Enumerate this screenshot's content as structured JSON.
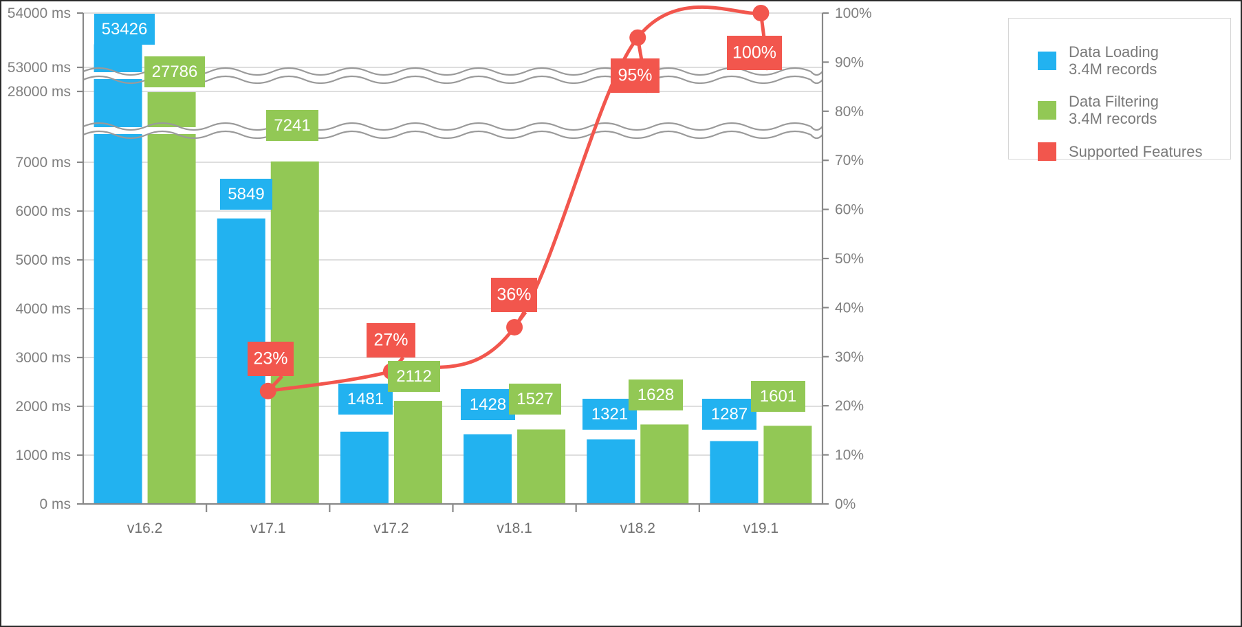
{
  "chart_data": {
    "type": "bar",
    "title": "",
    "subtitle": "",
    "xlabel": "",
    "ylabel": "",
    "y2label": "",
    "grid": true,
    "legend_position": "top-right",
    "broken_axis": true,
    "categories": [
      "v16.2",
      "v17.1",
      "v17.2",
      "v18.1",
      "v18.2",
      "v19.1"
    ],
    "series": [
      {
        "name": "Data Loading",
        "sublabel": "3.4M records",
        "type": "bar",
        "color": "#22b2f0",
        "axis": "left",
        "unit": "ms",
        "values": [
          53426,
          5849,
          1481,
          1428,
          1321,
          1287
        ]
      },
      {
        "name": "Data Filtering",
        "sublabel": "3.4M records",
        "type": "bar",
        "color": "#92c855",
        "axis": "left",
        "unit": "ms",
        "values": [
          27786,
          7241,
          2112,
          1527,
          1628,
          1601
        ]
      },
      {
        "name": "Supported Features",
        "sublabel": "",
        "type": "line",
        "color": "#f2564d",
        "axis": "right",
        "unit": "%",
        "values": [
          null,
          23,
          27,
          36,
          95,
          100
        ],
        "labels": [
          "",
          "23%",
          "27%",
          "36%",
          "95%",
          "100%"
        ]
      }
    ],
    "left_axis": {
      "unit": "ms",
      "tick_labels": [
        "54000 ms",
        "53000 ms",
        "28000 ms",
        "7000 ms",
        "6000 ms",
        "5000 ms",
        "4000 ms",
        "3000 ms",
        "2000 ms",
        "1000 ms",
        "0 ms"
      ],
      "tick_values": [
        54000,
        53000,
        28000,
        7000,
        6000,
        5000,
        4000,
        3000,
        2000,
        1000,
        0
      ]
    },
    "right_axis": {
      "unit": "%",
      "tick_labels": [
        "100%",
        "90%",
        "80%",
        "70%",
        "60%",
        "50%",
        "40%",
        "30%",
        "20%",
        "10%",
        "0%"
      ],
      "tick_values": [
        100,
        90,
        80,
        70,
        60,
        50,
        40,
        30,
        20,
        10,
        0
      ],
      "ylim": [
        0,
        100
      ]
    }
  },
  "legend": {
    "items": [
      {
        "label": "Data Loading\n3.4M records",
        "color": "#22b2f0"
      },
      {
        "label": "Data Filtering\n3.4M records",
        "color": "#92c855"
      },
      {
        "label": "Supported Features",
        "color": "#f2564d"
      }
    ]
  },
  "colors": {
    "data_loading": "#22b2f0",
    "data_filtering": "#92c855",
    "supported_features": "#f2564d",
    "gridline": "#d4d4d4",
    "axis": "#888888",
    "tick_text": "#7f7f7f",
    "border": "#2b2b2b"
  }
}
